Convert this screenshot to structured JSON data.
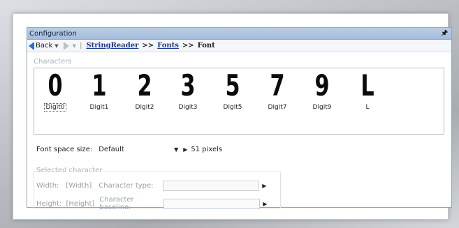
{
  "panel": {
    "title": "Configuration",
    "pin_glyph": "⊙"
  },
  "nav": {
    "back_label": "Back",
    "breadcrumb": [
      {
        "label": "StringReader",
        "link": true
      },
      {
        "label": ">>",
        "sep": true
      },
      {
        "label": "Fonts",
        "link": true
      },
      {
        "label": ">>",
        "sep": true
      },
      {
        "label": "Font",
        "current": true
      }
    ]
  },
  "characters": {
    "caption": "Characters",
    "items": [
      {
        "glyph": "0",
        "label": "Digit0",
        "selected": true
      },
      {
        "glyph": "1",
        "label": "Digit1"
      },
      {
        "glyph": "2",
        "label": "Digit2"
      },
      {
        "glyph": "3",
        "label": "Digit3"
      },
      {
        "glyph": "5",
        "label": "Digit5"
      },
      {
        "glyph": "7",
        "label": "Digit7"
      },
      {
        "glyph": "9",
        "label": "Digit9"
      },
      {
        "glyph": "L",
        "label": "L"
      }
    ]
  },
  "font_space": {
    "label": "Font space size:",
    "value": "Default",
    "pixels": "51 pixels"
  },
  "selected_character": {
    "caption": "Selected character",
    "width_label": "Width:",
    "width_value": "[Width]",
    "height_label": "Height:",
    "height_value": "[Height]",
    "type_label": "Character type:",
    "baseline_label": "Character baseline:"
  }
}
